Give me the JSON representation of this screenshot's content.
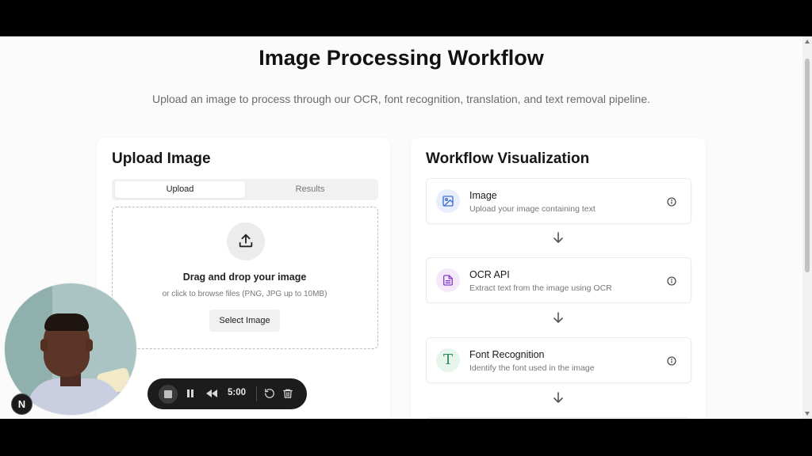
{
  "page": {
    "title": "Image Processing Workflow",
    "subtitle": "Upload an image to process through our OCR, font recognition, translation, and text removal pipeline."
  },
  "upload_panel": {
    "title": "Upload Image",
    "tabs": [
      {
        "label": "Upload",
        "active": true
      },
      {
        "label": "Results",
        "active": false
      }
    ],
    "dropzone": {
      "icon": "upload-icon",
      "title": "Drag and drop your image",
      "hint": "or click to browse files (PNG, JPG up to 10MB)",
      "button_label": "Select Image"
    }
  },
  "workflow_panel": {
    "title": "Workflow Visualization",
    "steps": [
      {
        "title": "Image",
        "description": "Upload your image containing text",
        "icon": "image-icon",
        "color": "#3b6fd8",
        "bg": "#e8eefb"
      },
      {
        "title": "OCR API",
        "description": "Extract text from the image using OCR",
        "icon": "document-icon",
        "color": "#8a3fc7",
        "bg": "#f3e9fb"
      },
      {
        "title": "Font Recognition",
        "description": "Identify the font used in the image",
        "icon": "font-t-icon",
        "glyph": "T",
        "color": "#2e8b57",
        "bg": "#e6f6ec"
      }
    ]
  },
  "recorder": {
    "time": "5:00",
    "controls": [
      "stop-icon",
      "pause-icon",
      "rewind-icon",
      "restart-icon",
      "trash-icon"
    ]
  },
  "overlay_logo": {
    "letter": "N"
  }
}
